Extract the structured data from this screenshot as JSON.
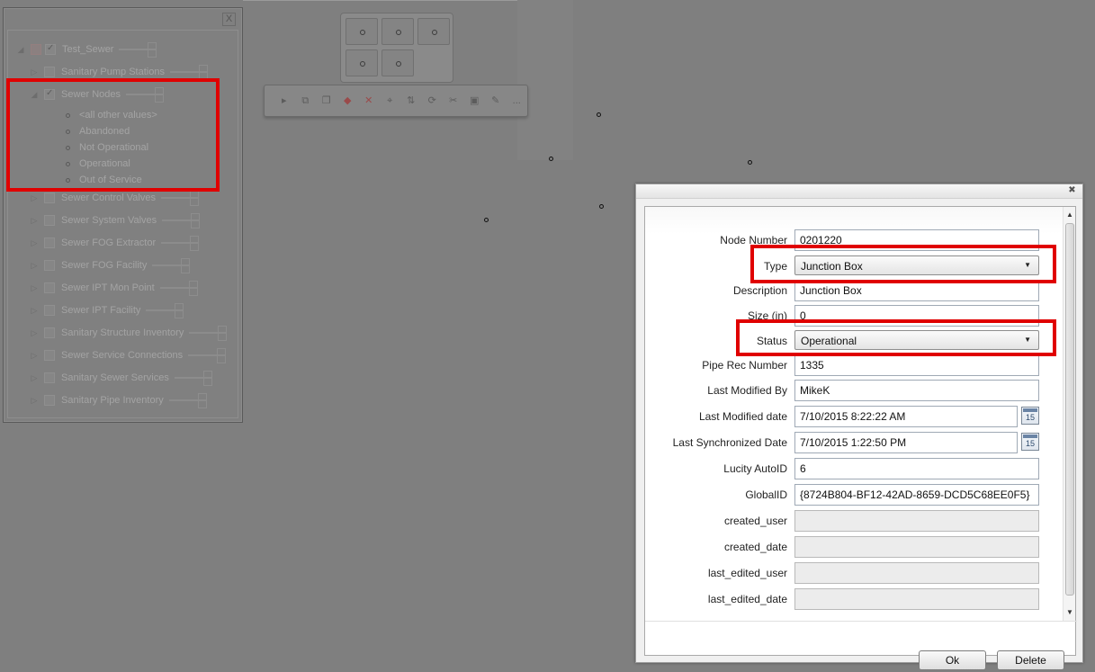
{
  "layers_panel": {
    "close_glyph": "X",
    "root": {
      "label": "Test_Sewer"
    },
    "items": [
      {
        "label": "Sanitary Pump Stations"
      },
      {
        "label": "Sewer Nodes"
      },
      {
        "label": "Sewer Control Valves"
      },
      {
        "label": "Sewer System Valves"
      },
      {
        "label": "Sewer FOG Extractor"
      },
      {
        "label": "Sewer FOG Facility"
      },
      {
        "label": "Sewer IPT Mon Point"
      },
      {
        "label": "Sewer IPT Facility"
      },
      {
        "label": "Sanitary Structure Inventory"
      },
      {
        "label": "Sewer Service Connections"
      },
      {
        "label": "Sanitary Sewer Services"
      },
      {
        "label": "Sanitary Pipe Inventory"
      }
    ],
    "legend": [
      "<all other values>",
      "Abandoned",
      "Not Operational",
      "Operational",
      "Out of Service"
    ]
  },
  "toolbar": {
    "more_label": "..."
  },
  "dialog": {
    "close_glyph": "✖",
    "fields": {
      "node_number": {
        "label": "Node Number",
        "value": "0201220"
      },
      "type": {
        "label": "Type",
        "value": "Junction Box"
      },
      "description": {
        "label": "Description",
        "value": "Junction Box"
      },
      "size": {
        "label": "Size (in)",
        "value": "0"
      },
      "status": {
        "label": "Status",
        "value": "Operational"
      },
      "pipe_rec_number": {
        "label": "Pipe Rec Number",
        "value": "1335"
      },
      "last_modified_by": {
        "label": "Last Modified By",
        "value": "MikeK"
      },
      "last_modified_date": {
        "label": "Last Modified date",
        "value": "7/10/2015 8:22:22 AM"
      },
      "last_synchronized_date": {
        "label": "Last Synchronized Date",
        "value": "7/10/2015 1:22:50 PM"
      },
      "lucity_autoid": {
        "label": "Lucity AutoID",
        "value": "6"
      },
      "globalid": {
        "label": "GlobalID",
        "value": "{8724B804-BF12-42AD-8659-DCD5C68EE0F5}"
      },
      "created_user": {
        "label": "created_user",
        "value": ""
      },
      "created_date": {
        "label": "created_date",
        "value": ""
      },
      "last_edited_user": {
        "label": "last_edited_user",
        "value": ""
      },
      "last_edited_date": {
        "label": "last_edited_date",
        "value": ""
      }
    },
    "calendar_day": "15",
    "ok_label": "Ok",
    "delete_label": "Delete"
  },
  "colors": {
    "highlight": "#e00000",
    "overlay": "#7f7f7f"
  }
}
